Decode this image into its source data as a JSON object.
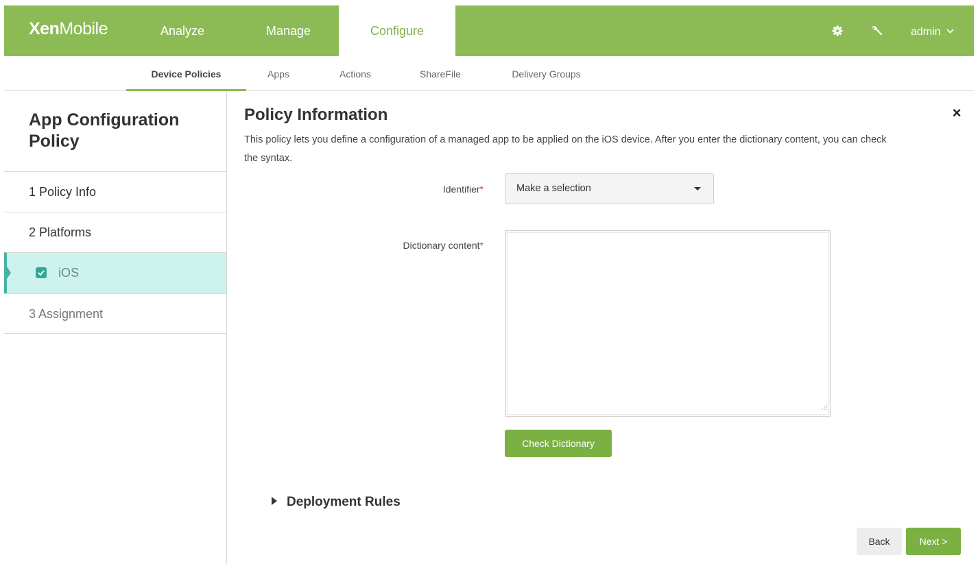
{
  "app": {
    "logo_bold": "Xen",
    "logo_rest": "Mobile"
  },
  "topnav": {
    "analyze": "Analyze",
    "manage": "Manage",
    "configure": "Configure",
    "user": "admin"
  },
  "subnav": {
    "device_policies": "Device Policies",
    "apps": "Apps",
    "actions": "Actions",
    "sharefile": "ShareFile",
    "delivery_groups": "Delivery Groups"
  },
  "sidebar": {
    "title": "App Configuration Policy",
    "steps": [
      "1  Policy Info",
      "2  Platforms",
      "iOS",
      "3  Assignment"
    ]
  },
  "main": {
    "title": "Policy Information",
    "description": "This policy lets you define a configuration of a managed app to be applied on the iOS device. After you enter the dictionary content, you can check the syntax.",
    "identifier_label": "Identifier",
    "identifier_value": "Make a selection",
    "dictionary_label": "Dictionary content",
    "dictionary_value": "",
    "check_button": "Check Dictionary",
    "deployment_rules": "Deployment Rules",
    "back_button": "Back",
    "next_button": "Next >",
    "required_mark": "*",
    "close_glyph": "×"
  },
  "colors": {
    "brand_green": "#8cbb56",
    "button_green": "#7bb043",
    "selected_bg": "#cef2ee",
    "required": "#e0491c"
  },
  "icons": {
    "settings": "gear-icon",
    "tools": "wrench-icon",
    "user_menu": "chevron-down-icon",
    "checkbox": "checkbox-checked-icon"
  }
}
